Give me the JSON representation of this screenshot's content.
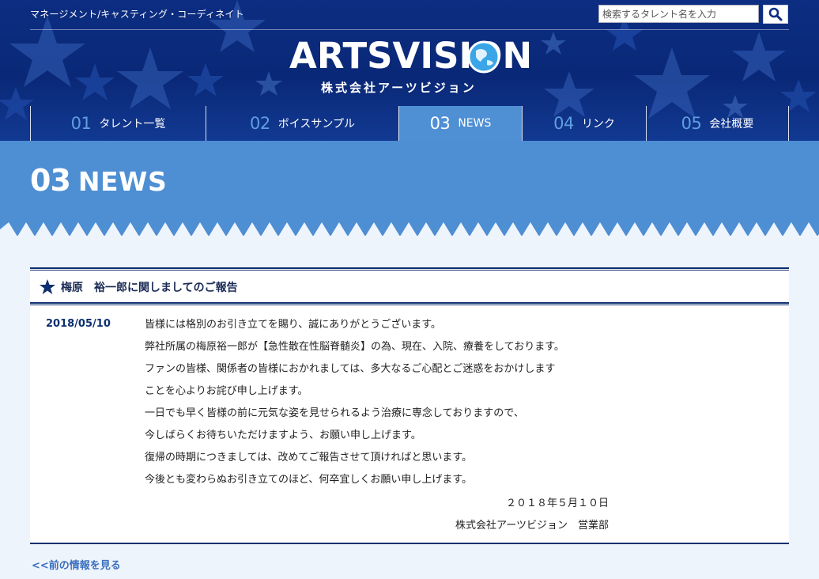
{
  "header": {
    "tagline": "マネージメント/キャスティング・コーディネイト",
    "search": {
      "placeholder": "検索するタレント名を入力",
      "value": ""
    },
    "logo": {
      "name": "ARTSVISION",
      "sub": "株式会社アーツビジョン"
    }
  },
  "nav": {
    "items": [
      {
        "num": "01",
        "label": "タレント一覧",
        "active": false
      },
      {
        "num": "02",
        "label": "ボイスサンプル",
        "active": false
      },
      {
        "num": "03",
        "label": "NEWS",
        "active": true
      },
      {
        "num": "04",
        "label": "リンク",
        "active": false
      },
      {
        "num": "05",
        "label": "会社概要",
        "active": false
      }
    ]
  },
  "page": {
    "num": "03",
    "label": "NEWS"
  },
  "article": {
    "title": "梅原　裕一郎に関しましてのご報告",
    "date": "2018/05/10",
    "lines": [
      "皆様には格別のお引き立てを賜り、誠にありがとうございます。",
      "弊社所属の梅原裕一郎が【急性散在性脳脊髄炎】の為、現在、入院、療養をしております。",
      "ファンの皆様、関係者の皆様におかれましては、多大なるご心配とご迷惑をおかけします",
      "ことを心よりお詫び申し上げます。",
      "一日でも早く皆様の前に元気な姿を見せられるよう治療に専念しておりますので、",
      "今しばらくお待ちいただけますよう、お願い申し上げます。",
      "復帰の時期につきましては、改めてご報告させて頂ければと思います。",
      "今後とも変わらぬお引き立てのほど、何卒宜しくお願い申し上げます。"
    ],
    "signature_date": "２０１８年５月１０日",
    "signature_org": "株式会社アーツビジョン　営業部"
  },
  "prev_link": "<<前の情報を見る",
  "colors": {
    "header_bg": "#0c2d82",
    "band": "#4e8ed3",
    "accent": "#0d2f6f",
    "link": "#3a6fbf"
  }
}
